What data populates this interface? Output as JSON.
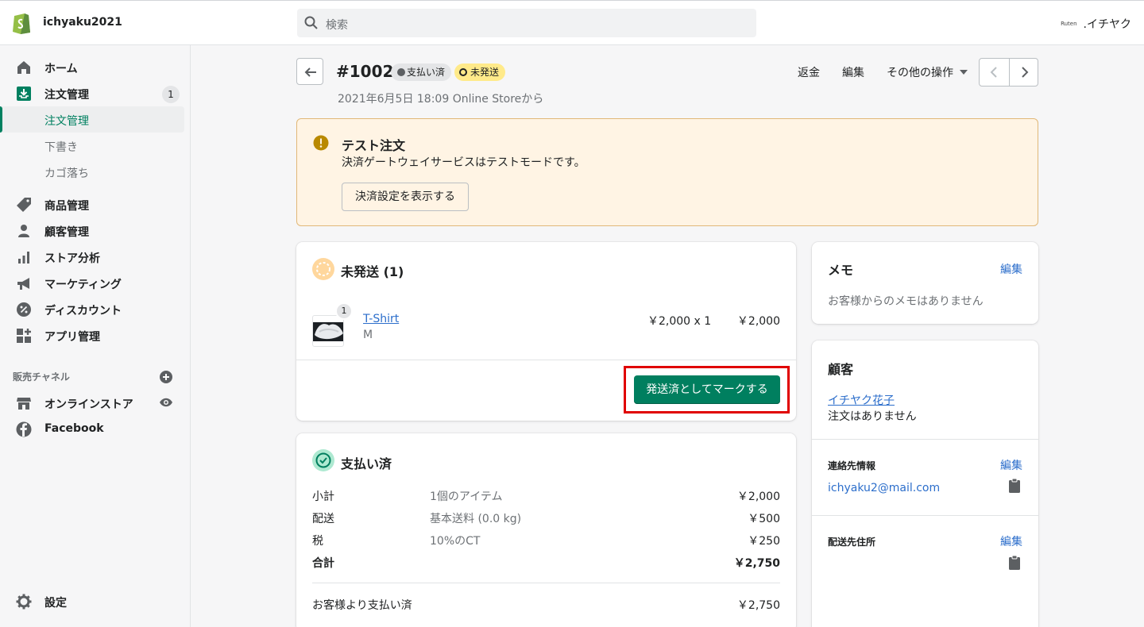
{
  "topbar": {
    "store_name": "ichyaku2021",
    "search_placeholder": "検索",
    "account_brand": "Ruten",
    "account_name": ".イチヤク"
  },
  "sidebar": {
    "items": [
      {
        "label": "ホーム",
        "icon": "home-icon"
      },
      {
        "label": "注文管理",
        "icon": "orders-icon",
        "badge": "1"
      },
      {
        "label": "商品管理",
        "icon": "tag-icon"
      },
      {
        "label": "顧客管理",
        "icon": "person-icon"
      },
      {
        "label": "ストア分析",
        "icon": "bar-chart-icon"
      },
      {
        "label": "マーケティング",
        "icon": "megaphone-icon"
      },
      {
        "label": "ディスカウント",
        "icon": "discount-icon"
      },
      {
        "label": "アプリ管理",
        "icon": "apps-icon"
      }
    ],
    "sub_items": [
      "注文管理",
      "下書き",
      "カゴ落ち"
    ],
    "sales_channels_title": "販売チャネル",
    "channels": [
      {
        "label": "オンラインストア",
        "icon": "store-icon"
      },
      {
        "label": "Facebook",
        "icon": "facebook-icon"
      }
    ],
    "settings_label": "設定"
  },
  "order": {
    "number": "#1002",
    "payment_status": "支払い済",
    "fulfillment_status": "未発送",
    "date": "2021年6月5日 18:09 Online Storeから",
    "actions": {
      "refund": "返金",
      "edit": "編集",
      "more": "その他の操作"
    }
  },
  "banner": {
    "title": "テスト注文",
    "text": "決済ゲートウェイサービスはテストモードです。",
    "button": "決済設定を表示する"
  },
  "unfulfilled": {
    "title": "未発送 (1)",
    "product_name": "T-Shirt",
    "variant": "M",
    "quantity_badge": "1",
    "price_qty": "￥2,000 x 1",
    "line_total": "￥2,000",
    "mark_button": "発送済としてマークする"
  },
  "payment": {
    "title": "支払い済",
    "rows": [
      {
        "label": "小計",
        "desc": "1個のアイテム",
        "amount": "￥2,000"
      },
      {
        "label": "配送",
        "desc": "基本送料 (0.0 kg)",
        "amount": "￥500"
      },
      {
        "label": "税",
        "desc": "10%のCT",
        "amount": "￥250"
      },
      {
        "label": "合計",
        "desc": "",
        "amount": "￥2,750"
      }
    ],
    "paid_by_customer_label": "お客様より支払い済",
    "paid_by_customer_amount": "￥2,750"
  },
  "memo": {
    "title": "メモ",
    "edit": "編集",
    "empty": "お客様からのメモはありません"
  },
  "customer": {
    "title": "顧客",
    "name": "イチヤク花子",
    "orders_text": "注文はありません",
    "contact_title": "連絡先情報",
    "contact_edit": "編集",
    "email": "ichyaku2@mail.com",
    "shipping_title": "配送先住所",
    "shipping_edit": "編集"
  },
  "colors": {
    "accent_green": "#008060",
    "button_green": "#007f5f",
    "link_blue": "#2c6ecb",
    "highlight_red": "#e00000",
    "warning_bg": "#fff4e4",
    "unfulfilled_yellow": "#ffea8a"
  }
}
